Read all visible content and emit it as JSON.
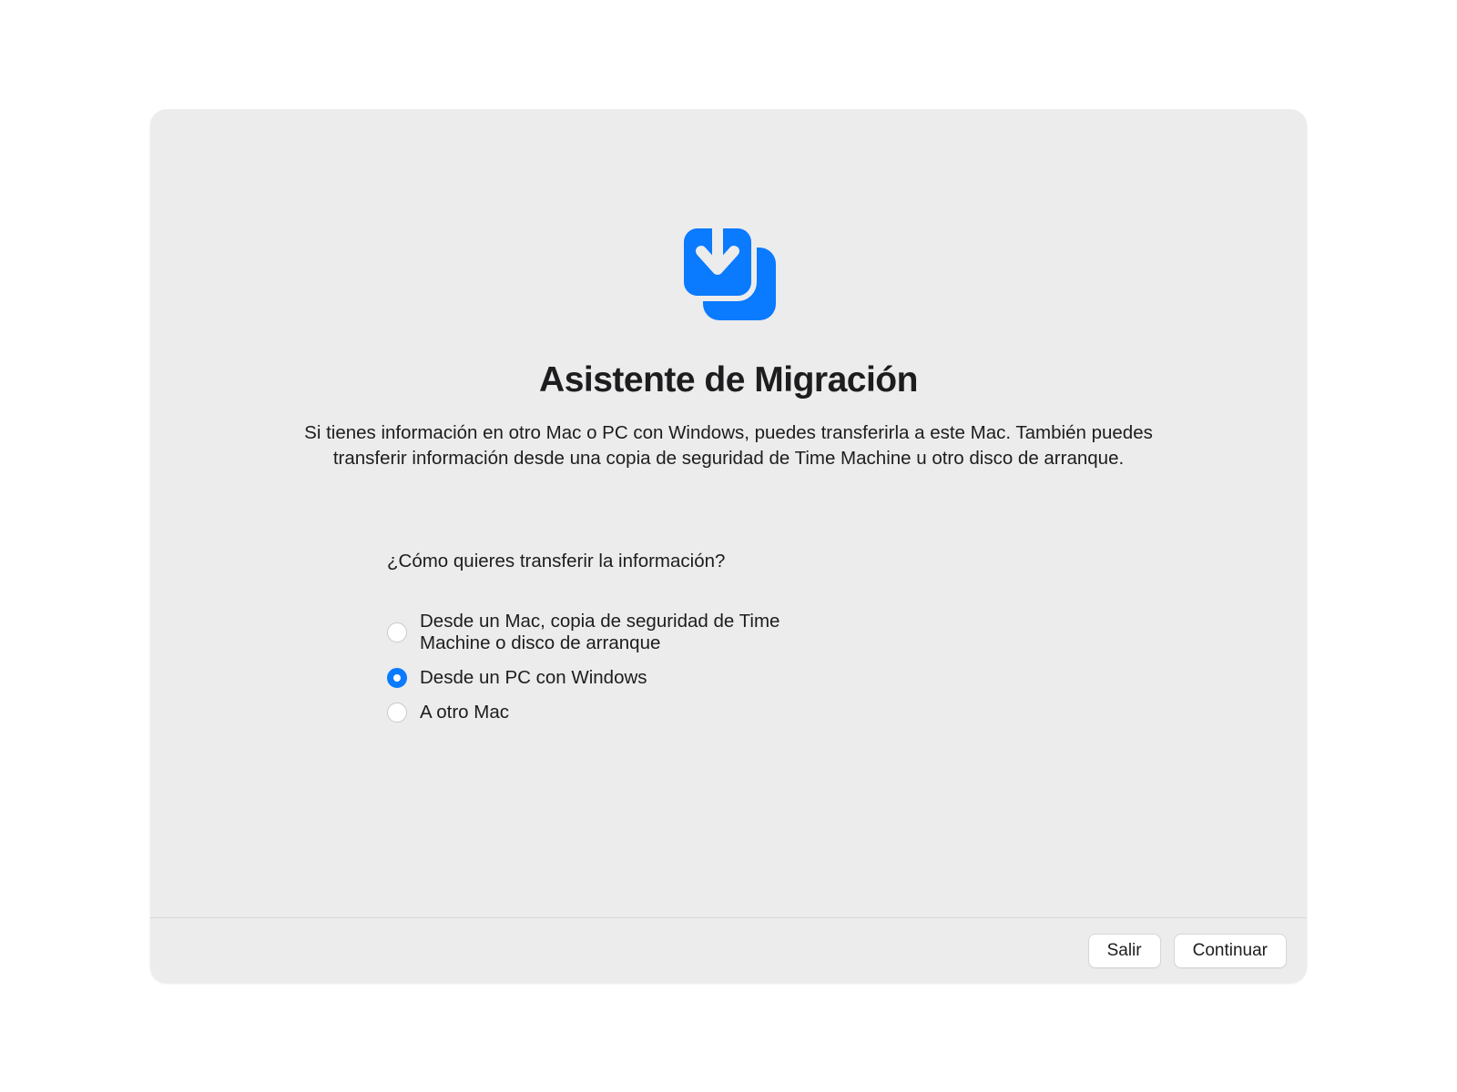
{
  "title": "Asistente de Migración",
  "description": "Si tienes información en otro Mac o PC con Windows, puedes transferirla a este Mac. También puedes transferir información desde una copia de seguridad de Time Machine u otro disco de arranque.",
  "prompt": "¿Cómo quieres transferir la información?",
  "options": {
    "from_mac": "Desde un Mac, copia de seguridad de Time Machine o disco de arranque",
    "from_windows": "Desde un PC con Windows",
    "to_mac": "A otro Mac"
  },
  "selected_option": "from_windows",
  "footer": {
    "exit": "Salir",
    "continue": "Continuar"
  },
  "colors": {
    "accent": "#0a7aff"
  }
}
